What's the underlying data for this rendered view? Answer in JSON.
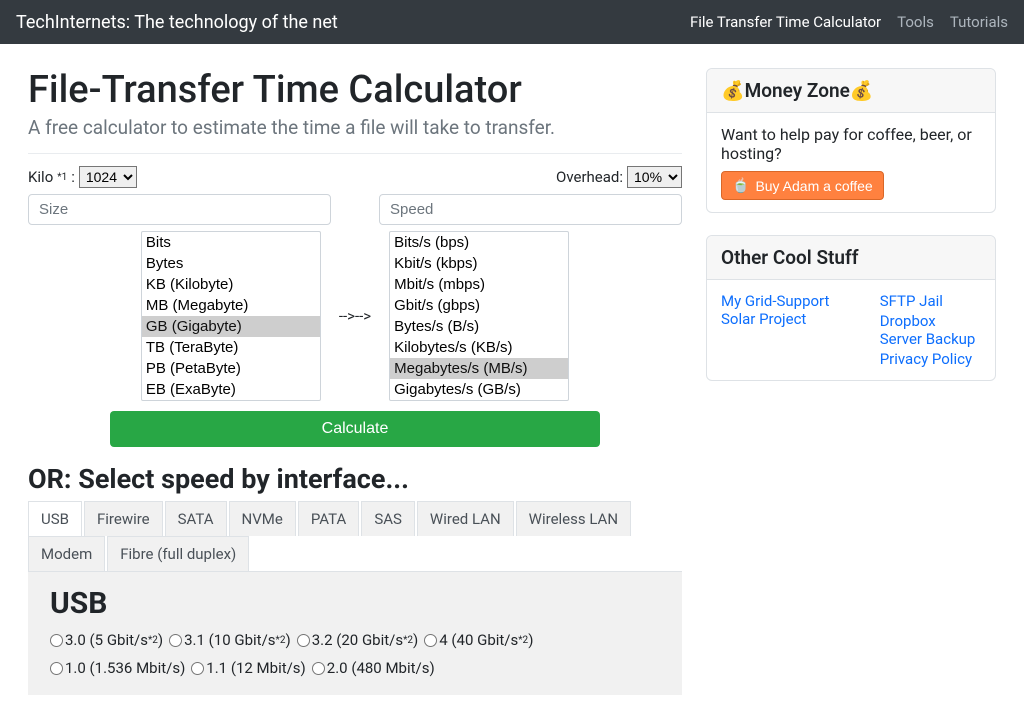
{
  "navbar": {
    "brand": "TechInternets: The technology of the net",
    "links": [
      "File Transfer Time Calculator",
      "Tools",
      "Tutorials"
    ],
    "active_index": 0
  },
  "page": {
    "title": "File-Transfer Time Calculator",
    "subtitle": "A free calculator to estimate the time a file will take to transfer."
  },
  "controls": {
    "kilo_label": "Kilo",
    "kilo_sup": "*1",
    "kilo_colon": ":",
    "kilo_value": "1024",
    "overhead_label": "Overhead:",
    "overhead_value": "10%",
    "size_placeholder": "Size",
    "speed_placeholder": "Speed",
    "arrow": "-->-->",
    "calculate": "Calculate"
  },
  "size_units": {
    "options": [
      "Bits",
      "Bytes",
      "KB (Kilobyte)",
      "MB (Megabyte)",
      "GB (Gigabyte)",
      "TB (TeraByte)",
      "PB (PetaByte)",
      "EB (ExaByte)"
    ],
    "selected": "GB (Gigabyte)"
  },
  "speed_units": {
    "options": [
      "Bits/s (bps)",
      "Kbit/s (kbps)",
      "Mbit/s (mbps)",
      "Gbit/s (gbps)",
      "Bytes/s (B/s)",
      "Kilobytes/s (KB/s)",
      "Megabytes/s (MB/s)",
      "Gigabytes/s (GB/s)"
    ],
    "selected": "Megabytes/s (MB/s)"
  },
  "interface": {
    "or_title": "OR: Select speed by interface...",
    "tabs": [
      "USB",
      "Firewire",
      "SATA",
      "NVMe",
      "PATA",
      "SAS",
      "Wired LAN",
      "Wireless LAN",
      "Modem",
      "Fibre (full duplex)"
    ],
    "active_tab": "USB",
    "panel_title": "USB",
    "rows": [
      [
        {
          "label": "3.0 (5 Gbit/s",
          "sup": "*2",
          "close": ")"
        },
        {
          "label": "3.1 (10 Gbit/s",
          "sup": "*2",
          "close": ")"
        },
        {
          "label": "3.2 (20 Gbit/s",
          "sup": "*2",
          "close": ")"
        },
        {
          "label": "4 (40 Gbit/s",
          "sup": "*2",
          "close": ")"
        }
      ],
      [
        {
          "label": "1.0 (1.536 Mbit/s)",
          "sup": "",
          "close": ""
        },
        {
          "label": "1.1 (12 Mbit/s)",
          "sup": "",
          "close": ""
        },
        {
          "label": "2.0 (480 Mbit/s)",
          "sup": "",
          "close": ""
        }
      ]
    ]
  },
  "money": {
    "title": "Money Zone",
    "emoji": "💰",
    "text": "Want to help pay for coffee, beer, or hosting?",
    "button": "Buy Adam a coffee",
    "cup": "🍵"
  },
  "cool": {
    "title": "Other Cool Stuff",
    "col1": [
      "My Grid-Support Solar Project"
    ],
    "col2": [
      "SFTP Jail",
      "Dropbox Server Backup",
      "Privacy Policy"
    ]
  }
}
